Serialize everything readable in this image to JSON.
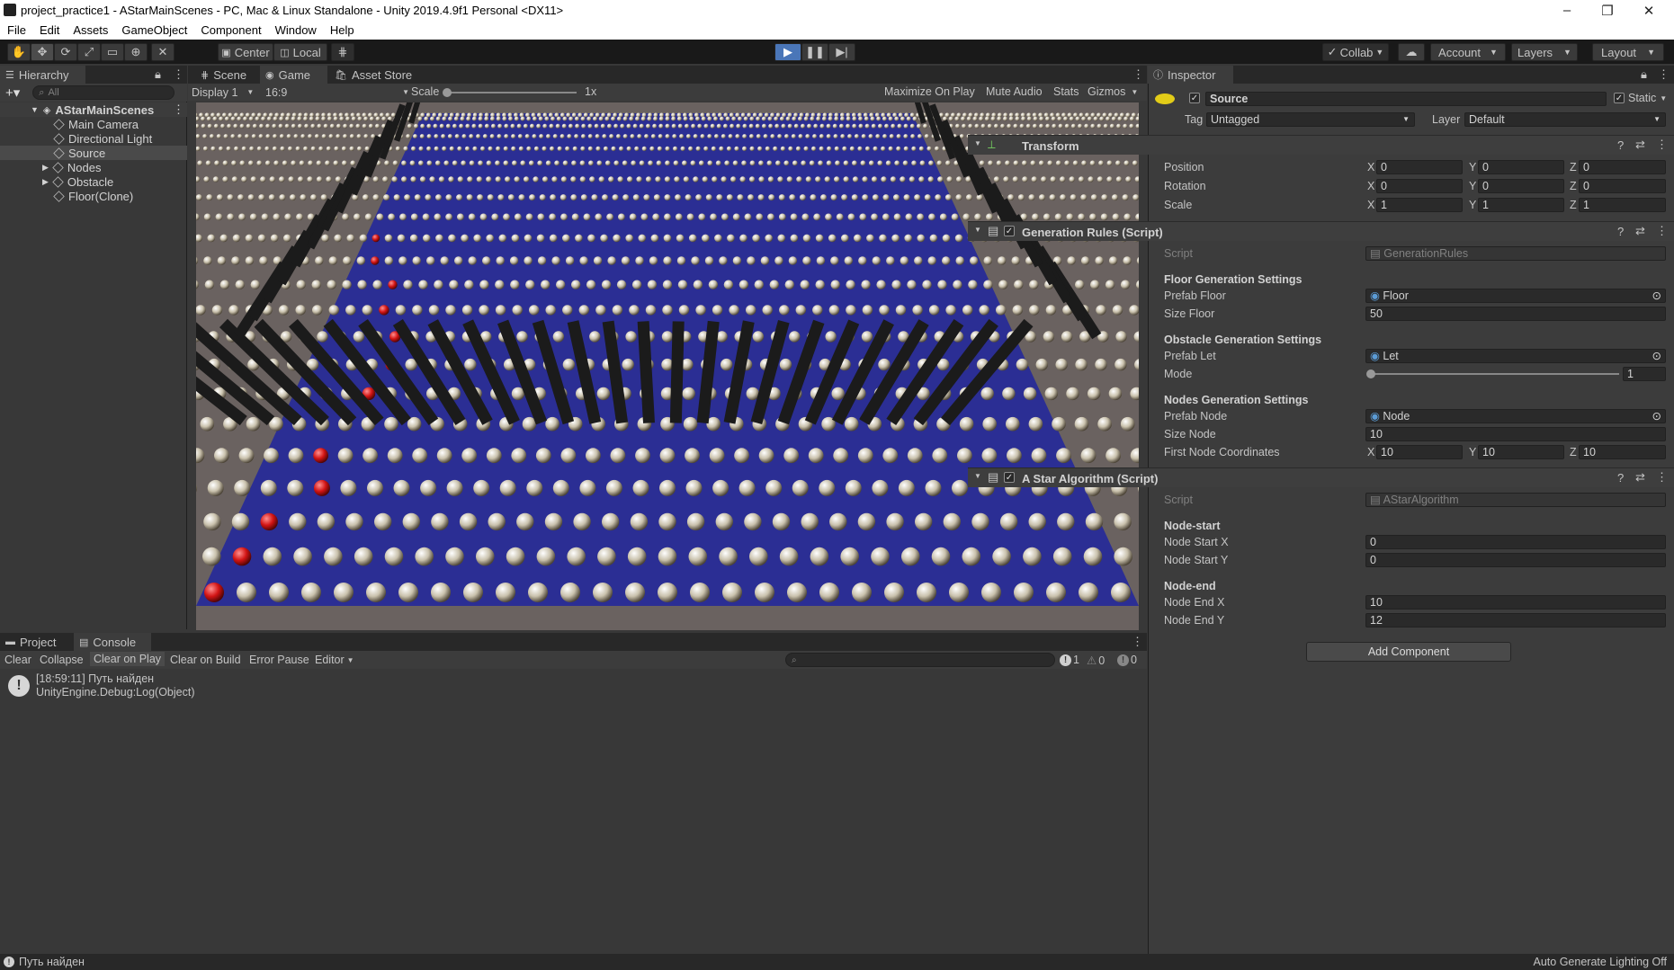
{
  "titlebar": {
    "title": "project_practice1 - AStarMainScenes - PC, Mac & Linux Standalone - Unity 2019.4.9f1 Personal <DX11>",
    "minimize": "–",
    "maximize": "❐",
    "close": "✕"
  },
  "menu": [
    "File",
    "Edit",
    "Assets",
    "GameObject",
    "Component",
    "Window",
    "Help"
  ],
  "toolbar": {
    "pivot": "Center",
    "space": "Local",
    "collab": "Collab",
    "account": "Account",
    "layers": "Layers",
    "layout": "Layout"
  },
  "hierarchy": {
    "tab": "Hierarchy",
    "search_placeholder": "All",
    "scene": "AStarMainScenes",
    "items": [
      "Main Camera",
      "Directional Light",
      "Source",
      "Nodes",
      "Obstacle",
      "Floor(Clone)"
    ]
  },
  "game": {
    "tabs": [
      "Scene",
      "Game",
      "Asset Store"
    ],
    "display": "Display 1",
    "aspect": "16:9",
    "scale_label": "Scale",
    "scale_value": "1x",
    "toggles": [
      "Maximize On Play",
      "Mute Audio",
      "Stats",
      "Gizmos"
    ]
  },
  "inspector": {
    "tab": "Inspector",
    "object_name": "Source",
    "static_label": "Static",
    "tag_label": "Tag",
    "tag_value": "Untagged",
    "layer_label": "Layer",
    "layer_value": "Default",
    "transform": {
      "title": "Transform",
      "rows": [
        {
          "label": "Position",
          "x": "0",
          "y": "0",
          "z": "0"
        },
        {
          "label": "Rotation",
          "x": "0",
          "y": "0",
          "z": "0"
        },
        {
          "label": "Scale",
          "x": "1",
          "y": "1",
          "z": "1"
        }
      ]
    },
    "gen_rules": {
      "title": "Generation Rules (Script)",
      "script_label": "Script",
      "script_value": "GenerationRules",
      "floor_header": "Floor Generation Settings",
      "prefab_floor_label": "Prefab Floor",
      "prefab_floor_value": "Floor",
      "size_floor_label": "Size Floor",
      "size_floor_value": "50",
      "obstacle_header": "Obstacle Generation Settings",
      "prefab_let_label": "Prefab Let",
      "prefab_let_value": "Let",
      "mode_label": "Mode",
      "mode_value": "1",
      "nodes_header": "Nodes Generation Settings",
      "prefab_node_label": "Prefab Node",
      "prefab_node_value": "Node",
      "size_node_label": "Size Node",
      "size_node_value": "10",
      "first_node_label": "First Node Coordinates",
      "first_node_x": "10",
      "first_node_y": "10",
      "first_node_z": "10"
    },
    "astar": {
      "title": "A Star Algorithm (Script)",
      "script_label": "Script",
      "script_value": "AStarAlgorithm",
      "start_header": "Node-start",
      "start_x_label": "Node Start X",
      "start_x_value": "0",
      "start_y_label": "Node Start Y",
      "start_y_value": "0",
      "end_header": "Node-end",
      "end_x_label": "Node End X",
      "end_x_value": "10",
      "end_y_label": "Node End Y",
      "end_y_value": "12"
    },
    "add_component": "Add Component"
  },
  "console": {
    "tabs": [
      "Project",
      "Console"
    ],
    "buttons": [
      "Clear",
      "Collapse",
      "Clear on Play",
      "Clear on Build",
      "Error Pause"
    ],
    "editor": "Editor",
    "counts": {
      "log": "1",
      "warn": "0",
      "error": "0"
    },
    "entry_line1": "[18:59:11] Путь найден",
    "entry_line2": "UnityEngine.Debug:Log(Object)"
  },
  "statusbar": {
    "message": "Путь найден",
    "lighting": "Auto Generate Lighting Off"
  }
}
